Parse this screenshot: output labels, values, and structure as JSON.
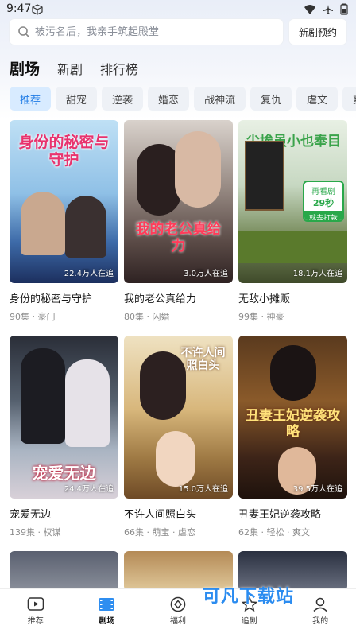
{
  "status": {
    "time": "9:47"
  },
  "search": {
    "placeholder": "被污名后，我亲手筑起殿堂",
    "new_button": "新剧预约"
  },
  "main_tabs": [
    {
      "label": "剧场",
      "active": true
    },
    {
      "label": "新剧",
      "active": false
    },
    {
      "label": "排行榜",
      "active": false
    }
  ],
  "categories": [
    "推荐",
    "甜宠",
    "逆袭",
    "婚恋",
    "战神流",
    "复仇",
    "虐文",
    "爽"
  ],
  "dramas": [
    {
      "name": "身份的秘密与守护",
      "episodes": "90集",
      "tags": "豪门",
      "watching": "22.4万人在追",
      "poster_text": "身份的秘密与守护"
    },
    {
      "name": "我的老公真给力",
      "episodes": "80集",
      "tags": "闪婚",
      "watching": "3.0万人在追",
      "poster_text": "我的老公真给力"
    },
    {
      "name": "无敌小摊贩",
      "episodes": "99集",
      "tags": "神豪",
      "watching": "18.1万人在追",
      "poster_text": "尘埃虽小也奉目"
    },
    {
      "name": "宠爱无边",
      "episodes": "139集",
      "tags": "权谋",
      "watching": "24.4万人在追",
      "poster_text": "宠爱无边"
    },
    {
      "name": "不许人间照白头",
      "episodes": "66集",
      "tags": "萌宝 · 虐恋",
      "watching": "15.0万人在追",
      "poster_text": "不许人间照白头"
    },
    {
      "name": "丑妻王妃逆袭攻略",
      "episodes": "62集",
      "tags": "轻松 · 爽文",
      "watching": "39.5万人在追",
      "poster_text": "丑妻王妃逆袭攻略"
    }
  ],
  "ad_badge": {
    "line1": "再看剧",
    "line2": "29秒",
    "line3": "就去打款"
  },
  "bottom_nav": [
    {
      "label": "推荐",
      "icon": "play-icon"
    },
    {
      "label": "剧场",
      "icon": "film-icon",
      "active": true
    },
    {
      "label": "福利",
      "icon": "gift-icon"
    },
    {
      "label": "追剧",
      "icon": "star-icon"
    },
    {
      "label": "我的",
      "icon": "user-icon"
    }
  ],
  "watermark": "可凡下载站"
}
